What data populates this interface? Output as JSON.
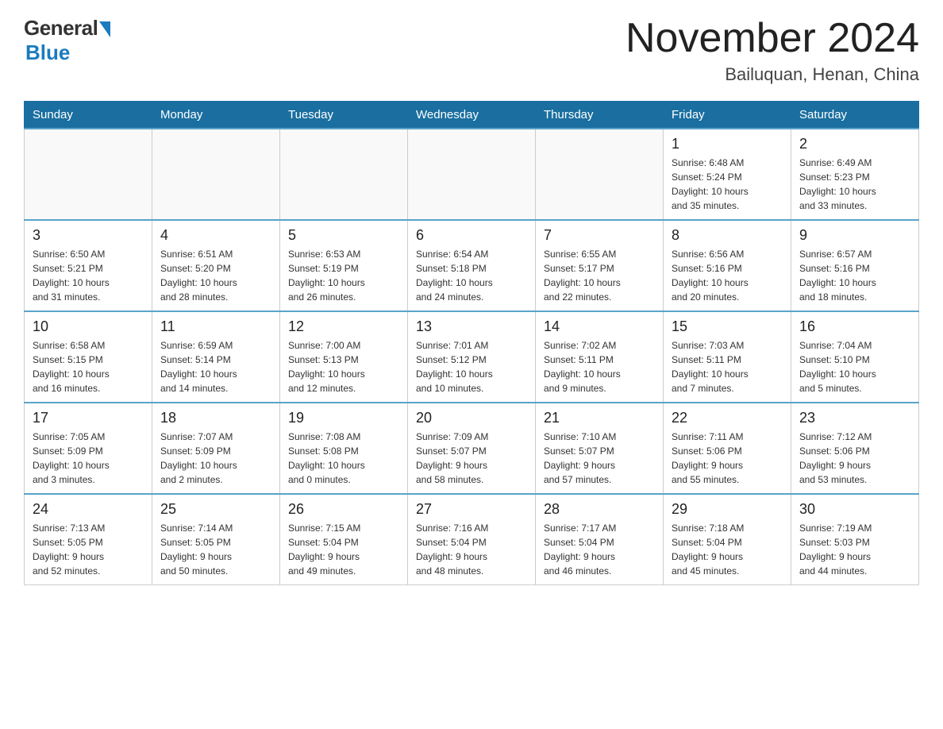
{
  "header": {
    "logo_general": "General",
    "logo_blue": "Blue",
    "month_year": "November 2024",
    "location": "Bailuquan, Henan, China"
  },
  "weekdays": [
    "Sunday",
    "Monday",
    "Tuesday",
    "Wednesday",
    "Thursday",
    "Friday",
    "Saturday"
  ],
  "weeks": [
    [
      {
        "day": "",
        "info": ""
      },
      {
        "day": "",
        "info": ""
      },
      {
        "day": "",
        "info": ""
      },
      {
        "day": "",
        "info": ""
      },
      {
        "day": "",
        "info": ""
      },
      {
        "day": "1",
        "info": "Sunrise: 6:48 AM\nSunset: 5:24 PM\nDaylight: 10 hours\nand 35 minutes."
      },
      {
        "day": "2",
        "info": "Sunrise: 6:49 AM\nSunset: 5:23 PM\nDaylight: 10 hours\nand 33 minutes."
      }
    ],
    [
      {
        "day": "3",
        "info": "Sunrise: 6:50 AM\nSunset: 5:21 PM\nDaylight: 10 hours\nand 31 minutes."
      },
      {
        "day": "4",
        "info": "Sunrise: 6:51 AM\nSunset: 5:20 PM\nDaylight: 10 hours\nand 28 minutes."
      },
      {
        "day": "5",
        "info": "Sunrise: 6:53 AM\nSunset: 5:19 PM\nDaylight: 10 hours\nand 26 minutes."
      },
      {
        "day": "6",
        "info": "Sunrise: 6:54 AM\nSunset: 5:18 PM\nDaylight: 10 hours\nand 24 minutes."
      },
      {
        "day": "7",
        "info": "Sunrise: 6:55 AM\nSunset: 5:17 PM\nDaylight: 10 hours\nand 22 minutes."
      },
      {
        "day": "8",
        "info": "Sunrise: 6:56 AM\nSunset: 5:16 PM\nDaylight: 10 hours\nand 20 minutes."
      },
      {
        "day": "9",
        "info": "Sunrise: 6:57 AM\nSunset: 5:16 PM\nDaylight: 10 hours\nand 18 minutes."
      }
    ],
    [
      {
        "day": "10",
        "info": "Sunrise: 6:58 AM\nSunset: 5:15 PM\nDaylight: 10 hours\nand 16 minutes."
      },
      {
        "day": "11",
        "info": "Sunrise: 6:59 AM\nSunset: 5:14 PM\nDaylight: 10 hours\nand 14 minutes."
      },
      {
        "day": "12",
        "info": "Sunrise: 7:00 AM\nSunset: 5:13 PM\nDaylight: 10 hours\nand 12 minutes."
      },
      {
        "day": "13",
        "info": "Sunrise: 7:01 AM\nSunset: 5:12 PM\nDaylight: 10 hours\nand 10 minutes."
      },
      {
        "day": "14",
        "info": "Sunrise: 7:02 AM\nSunset: 5:11 PM\nDaylight: 10 hours\nand 9 minutes."
      },
      {
        "day": "15",
        "info": "Sunrise: 7:03 AM\nSunset: 5:11 PM\nDaylight: 10 hours\nand 7 minutes."
      },
      {
        "day": "16",
        "info": "Sunrise: 7:04 AM\nSunset: 5:10 PM\nDaylight: 10 hours\nand 5 minutes."
      }
    ],
    [
      {
        "day": "17",
        "info": "Sunrise: 7:05 AM\nSunset: 5:09 PM\nDaylight: 10 hours\nand 3 minutes."
      },
      {
        "day": "18",
        "info": "Sunrise: 7:07 AM\nSunset: 5:09 PM\nDaylight: 10 hours\nand 2 minutes."
      },
      {
        "day": "19",
        "info": "Sunrise: 7:08 AM\nSunset: 5:08 PM\nDaylight: 10 hours\nand 0 minutes."
      },
      {
        "day": "20",
        "info": "Sunrise: 7:09 AM\nSunset: 5:07 PM\nDaylight: 9 hours\nand 58 minutes."
      },
      {
        "day": "21",
        "info": "Sunrise: 7:10 AM\nSunset: 5:07 PM\nDaylight: 9 hours\nand 57 minutes."
      },
      {
        "day": "22",
        "info": "Sunrise: 7:11 AM\nSunset: 5:06 PM\nDaylight: 9 hours\nand 55 minutes."
      },
      {
        "day": "23",
        "info": "Sunrise: 7:12 AM\nSunset: 5:06 PM\nDaylight: 9 hours\nand 53 minutes."
      }
    ],
    [
      {
        "day": "24",
        "info": "Sunrise: 7:13 AM\nSunset: 5:05 PM\nDaylight: 9 hours\nand 52 minutes."
      },
      {
        "day": "25",
        "info": "Sunrise: 7:14 AM\nSunset: 5:05 PM\nDaylight: 9 hours\nand 50 minutes."
      },
      {
        "day": "26",
        "info": "Sunrise: 7:15 AM\nSunset: 5:04 PM\nDaylight: 9 hours\nand 49 minutes."
      },
      {
        "day": "27",
        "info": "Sunrise: 7:16 AM\nSunset: 5:04 PM\nDaylight: 9 hours\nand 48 minutes."
      },
      {
        "day": "28",
        "info": "Sunrise: 7:17 AM\nSunset: 5:04 PM\nDaylight: 9 hours\nand 46 minutes."
      },
      {
        "day": "29",
        "info": "Sunrise: 7:18 AM\nSunset: 5:04 PM\nDaylight: 9 hours\nand 45 minutes."
      },
      {
        "day": "30",
        "info": "Sunrise: 7:19 AM\nSunset: 5:03 PM\nDaylight: 9 hours\nand 44 minutes."
      }
    ]
  ]
}
